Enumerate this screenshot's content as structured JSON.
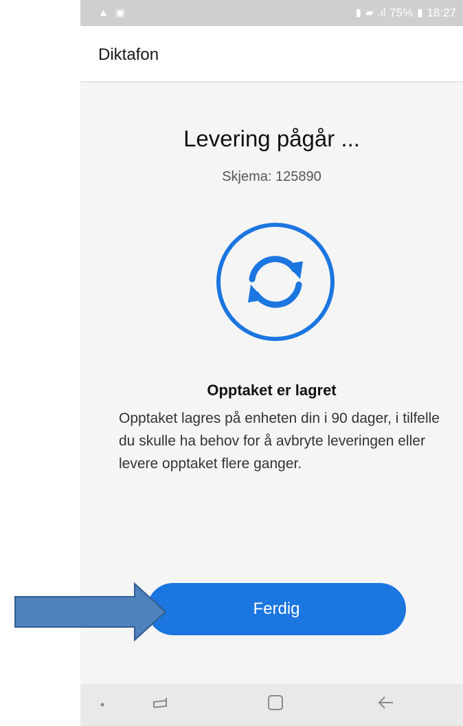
{
  "status_bar": {
    "left_icons": [
      "warning-icon",
      "image-icon"
    ],
    "right_text": "75%",
    "time": "18:27",
    "background": "#cfcfcf"
  },
  "app_bar": {
    "title": "Diktafon"
  },
  "delivery": {
    "heading": "Levering pågår ...",
    "form_label": "Skjema: 125890",
    "icon": "sync-icon",
    "accent_color": "#1b76e0"
  },
  "message": {
    "title": "Opptaket er lagret",
    "body": "Opptaket lagres på enheten din i 90 dager, i tilfelle du skulle ha behov for å avbryte leveringen eller levere opptaket flere ganger."
  },
  "actions": {
    "done_label": "Ferdig"
  },
  "nav_bar": {
    "icons": [
      "dot-icon",
      "recents-icon",
      "home-icon",
      "back-icon"
    ]
  },
  "annotation": {
    "icon": "arrow-right-icon",
    "color": "#4f81bd"
  }
}
